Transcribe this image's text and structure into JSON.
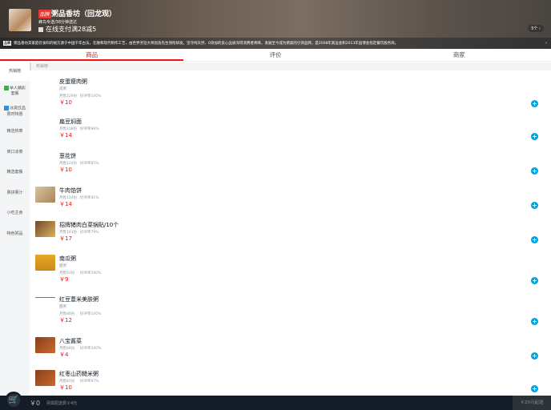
{
  "header": {
    "brand_badge": "品牌",
    "name": "粥品香坊（回龙观）",
    "description": "蜂鸟专送/38分钟送达",
    "support": "在线支付满28减5",
    "support_count": "5个 ›"
  },
  "notice": {
    "badge": "品牌",
    "text": "粥品香坊其家庭饮食料的秘方源于中国千年古法，在融和现代制作工艺，由世界烹饪大师屈浩先生领衔研发。坚守纯天然、0添加的良心品质深得消费者青睐，发展至今成为粥类的引领品牌。是2008年奥运会和2013年园博会指定餐饮服务商。",
    "arrow": "›"
  },
  "tabs": [
    "商品",
    "评价",
    "商家"
  ],
  "sidebar": [
    "热销榜",
    "单人精彩套餐",
    "冰爽饮品限时特惠",
    "精选热菜",
    "爽口凉菜",
    "精选套餐",
    "果拼果汁",
    "小吃主食",
    "特色粥品"
  ],
  "category_title": "热销榜",
  "items": [
    {
      "name": "皮蛋瘦肉粥",
      "desc": "咸粥",
      "sales": "月售229份",
      "rating": "好评率100%",
      "price": "￥10"
    },
    {
      "name": "扁豆焖面",
      "desc": "",
      "sales": "月售108份",
      "rating": "好评率96%",
      "price": "￥14"
    },
    {
      "name": "葱花饼",
      "desc": "",
      "sales": "月售124份",
      "rating": "好评率85%",
      "price": "￥10"
    },
    {
      "name": "牛肉馅饼",
      "desc": "",
      "sales": "月售114份",
      "rating": "好评率91%",
      "price": "￥14"
    },
    {
      "name": "招牌猪肉白菜锅贴/10个",
      "desc": "",
      "sales": "月售101份",
      "rating": "好评率79%",
      "price": "￥17"
    },
    {
      "name": "南瓜粥",
      "desc": "甜粥",
      "sales": "月售91份",
      "rating": "好评率100%",
      "price": "￥9"
    },
    {
      "name": "红豆薏米美肤粥",
      "desc": "甜粥",
      "sales": "月售86份",
      "rating": "好评率100%",
      "price": "￥12"
    },
    {
      "name": "八宝酱菜",
      "desc": "",
      "sales": "月售84份",
      "rating": "好评率100%",
      "price": "￥4"
    },
    {
      "name": "红枣山药糙米粥",
      "desc": "",
      "sales": "月售81份",
      "rating": "好评率97%",
      "price": "￥10"
    }
  ],
  "footer": {
    "total": "￥0",
    "delivery_fee": "另需配送费￥4元",
    "min_price": "￥20元起送"
  },
  "colors": {
    "accent": "#f01414",
    "add": "#00a0dc",
    "footer": "#141d27"
  }
}
